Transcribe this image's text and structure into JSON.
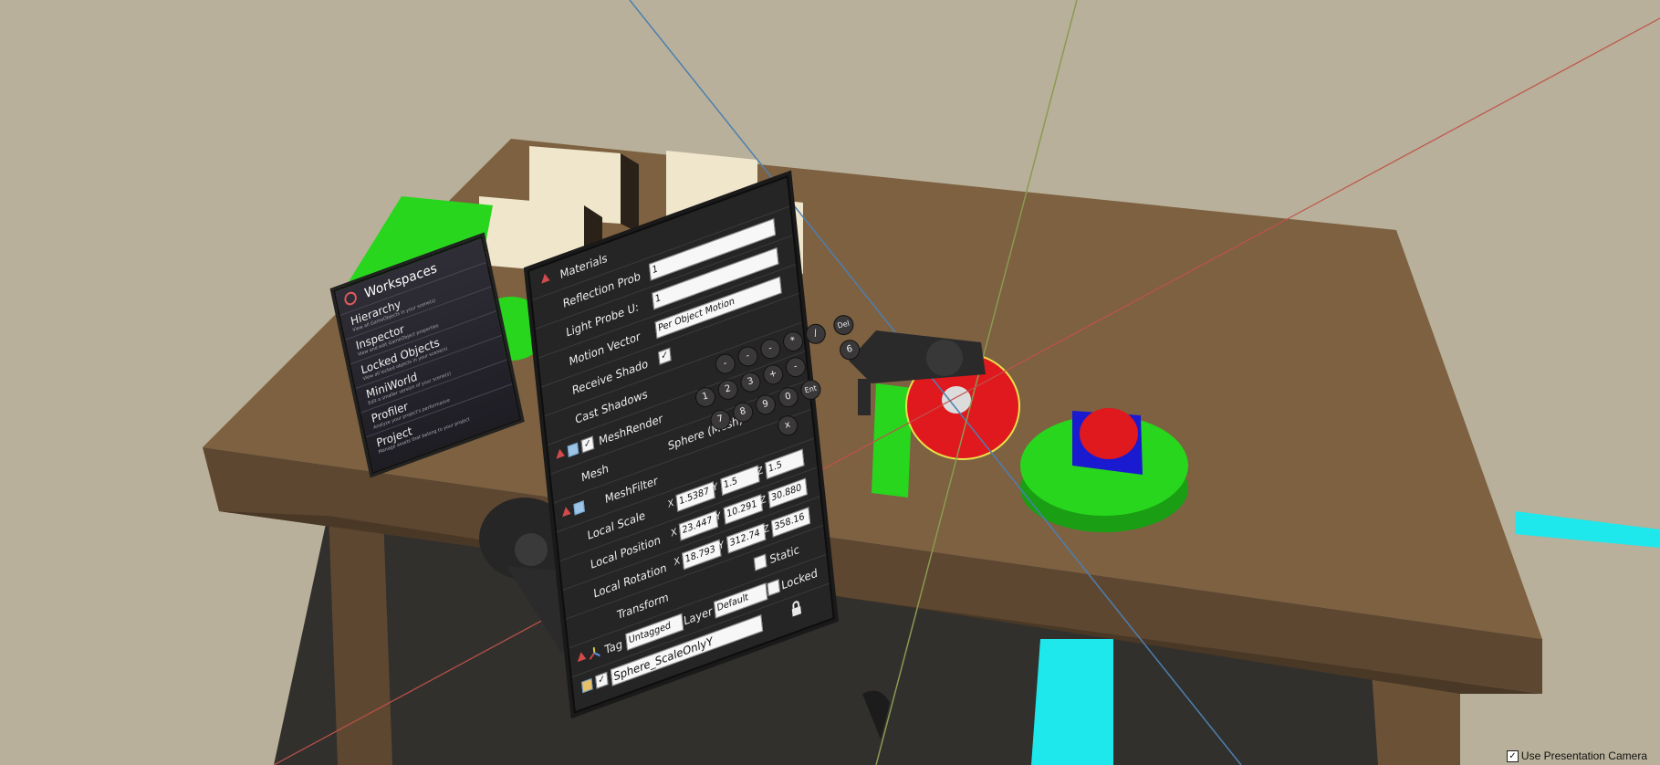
{
  "workspaces": {
    "title": "Workspaces",
    "items": [
      {
        "name": "Hierarchy",
        "desc": "View all GameObjects in your scene(s)"
      },
      {
        "name": "Inspector",
        "desc": "View and edit GameObject properties"
      },
      {
        "name": "Locked Objects",
        "desc": "View all locked objects in your scene(s)"
      },
      {
        "name": "MiniWorld",
        "desc": "Edit a smaller version of your scene(s)"
      },
      {
        "name": "Profiler",
        "desc": "Analyze your project's performance"
      },
      {
        "name": "Project",
        "desc": "Manage assets that belong to your project"
      }
    ]
  },
  "inspector": {
    "materials_label": "Materials",
    "reflection_probes_label": "Reflection Prob",
    "reflection_probes_value": "1",
    "light_probe_label": "Light Probe U:",
    "light_probe_value": "1",
    "motion_vectors_label": "Motion Vector",
    "motion_vectors_value": "Per Object Motion",
    "receive_shadows_label": "Receive Shado",
    "cast_shadows_label": "Cast Shadows",
    "mesh_renderer_label": "MeshRender",
    "mesh_label": "Mesh",
    "mesh_value": "Sphere (Mesh)",
    "mesh_filter_label": "MeshFilter",
    "local_scale_label": "Local Scale",
    "local_scale": {
      "x": "1.5387",
      "y": "1.5",
      "z": "1.5"
    },
    "local_position_label": "Local Position",
    "local_position": {
      "x": "23.447",
      "y": "10.291",
      "z": "30.880"
    },
    "local_rotation_label": "Local Rotation",
    "local_rotation": {
      "x": "18.793",
      "y": "312.74",
      "z": "358.16"
    },
    "transform_label": "Transform",
    "static_label": "Static",
    "layer_label": "Layer",
    "layer_value": "Default",
    "locked_label": "Locked",
    "tag_label": "Tag",
    "tag_value": "Untagged",
    "object_name": "Sphere_ScaleOnlyY",
    "axis_x": "X",
    "axis_y": "Y",
    "axis_z": "Z"
  },
  "keypad": {
    "row1": [
      "-",
      "-",
      "-",
      "*",
      "/",
      "Del"
    ],
    "row2": [
      "1",
      "2",
      "3",
      "+",
      "-",
      "6"
    ],
    "row3": [
      "7",
      "8",
      "9",
      "0",
      "Ent"
    ],
    "row4": [
      "x"
    ]
  },
  "footer": {
    "checkbox_checked": true,
    "label": "Use Presentation Camera"
  },
  "colors": {
    "table_top": "#7d6141",
    "table_side": "#5e4730",
    "ground": "#b8b09a",
    "green": "#27d61d",
    "red": "#e0191e",
    "blue": "#1a1ad0",
    "cyan": "#1ee8ec",
    "panel": "#262525"
  }
}
